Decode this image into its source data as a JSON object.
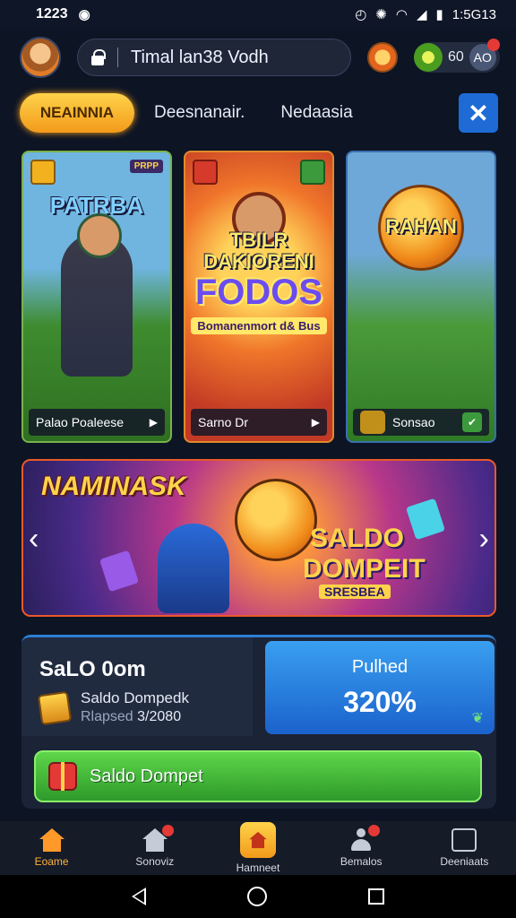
{
  "status_bar": {
    "time": "1223",
    "right_text": "1:5G13"
  },
  "header": {
    "search_text": "Timal lan38 Vodh",
    "balance": "60",
    "notification_label": "AO"
  },
  "tabs": {
    "active": "NEAINNIA",
    "items": [
      "Deesnanair.",
      "Nedaasia"
    ]
  },
  "cards": [
    {
      "tag": "PRPP",
      "title": "PATRBA",
      "footer": "Palao Poaleese"
    },
    {
      "title": "TBILR DAKIORENI",
      "big": "FODOS",
      "subtitle": "Bomanenmort d& Bus",
      "footer": "Sarno Dr"
    },
    {
      "title": "RAHAN",
      "footer": "Sonsao"
    }
  ],
  "banner": {
    "title": "NAMINASK",
    "line1": "SALDO",
    "line2": "DOMPEIT",
    "line3": "SRESBEA"
  },
  "wallet": {
    "title": "SaLO 0om",
    "label": "Saldo Dompedk",
    "date_prefix": "Rlapsed",
    "date_value": "3/2080",
    "bonus_title": "Pulhed",
    "bonus_value": "320%",
    "button_label": "Saldo Dompet"
  },
  "bottom_nav": [
    {
      "label": "Eoame"
    },
    {
      "label": "Sonoviz"
    },
    {
      "label": "Hamneet"
    },
    {
      "label": "Bemalos"
    },
    {
      "label": "Deeniaats"
    }
  ],
  "colors": {
    "accent_orange": "#f29a1a",
    "accent_blue": "#1e6bd6",
    "accent_green": "#3cb83a",
    "background": "#0d1424"
  },
  "icons": [
    "search-lock-icon",
    "coin-icon",
    "leaf-icon",
    "close-icon",
    "gift-icon",
    "home-icon",
    "person-icon"
  ]
}
